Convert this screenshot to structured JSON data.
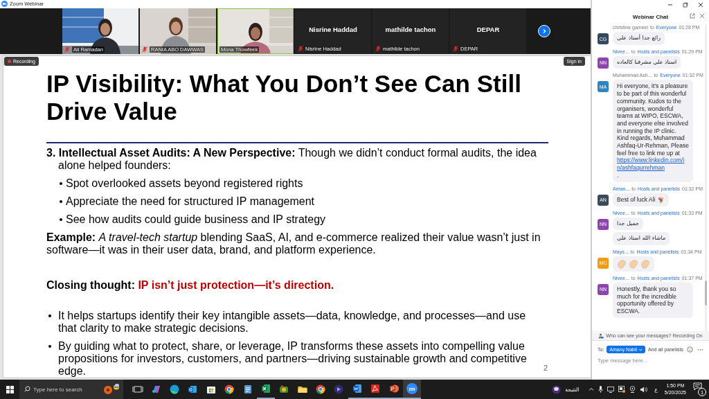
{
  "window": {
    "title": "Zoom Webinar"
  },
  "video_strip": {
    "tiles": [
      {
        "kind": "video",
        "name": "Ali Ramadan",
        "muted": true,
        "highlighted": false
      },
      {
        "kind": "video",
        "name": "RANIA ABO DAWWAS",
        "muted": true,
        "highlighted": false
      },
      {
        "kind": "video",
        "name": "Mona Thowfeek",
        "muted": false,
        "highlighted": true
      },
      {
        "kind": "name",
        "title": "Nisrine Haddad",
        "name": "Nisrine Haddad",
        "muted": true,
        "highlighted": false
      },
      {
        "kind": "name",
        "title": "mathilde tachon",
        "name": "mathilde tachon",
        "muted": true,
        "highlighted": false
      },
      {
        "kind": "name",
        "title": "DEPAR",
        "name": "DEPAR",
        "muted": true,
        "highlighted": false
      }
    ]
  },
  "recording": {
    "label": "Recording"
  },
  "sign_in": {
    "label": "Sign in"
  },
  "slide": {
    "title": "IP Visibility: What You Don’t See Can Still Drive Value",
    "blocks": [
      {
        "kind": "numbered",
        "text": "**3. Intellectual Asset Audits: A New Perspective:** Though we didn’t conduct formal audits, the idea alone helped founders:"
      },
      {
        "kind": "sub_bullet",
        "text": "Spot overlooked assets beyond registered rights"
      },
      {
        "kind": "sub_bullet",
        "text": "Appreciate the need for structured IP management"
      },
      {
        "kind": "sub_bullet",
        "text": "See how audits could guide business and IP strategy"
      },
      {
        "kind": "paragraph",
        "text": "**Example:** *A travel-tech startup* blending SaaS, AI, and e-commerce realized their value wasn’t just in software—it was in their user data, brand, and platform experience."
      },
      {
        "kind": "closing",
        "label": "Closing thought:",
        "emphasis": "IP isn’t just protection—it’s direction."
      },
      {
        "kind": "bullet",
        "text": "It helps startups identify their key intangible assets—data, knowledge, and processes—and use that clarity to make strategic decisions."
      },
      {
        "kind": "bullet",
        "text": "By guiding what to protect, share, or leverage, IP transforms these assets into compelling value propositions for investors, customers, and partners—driving sustainable growth and competitive edge."
      }
    ],
    "page_number": "2"
  },
  "chat": {
    "title": "Webinar Chat",
    "messages": [
      {
        "sender": "christine gameel",
        "sender_link": false,
        "to_label": "to",
        "recipient": "Everyone",
        "time": "01:28 PM",
        "initials": "CG",
        "color": "#34495e",
        "bubbles": [
          {
            "kind": "text",
            "text": "رائع جدا أستاذ علي"
          }
        ]
      },
      {
        "sender": "Nivee...",
        "sender_link": true,
        "to_label": "to",
        "recipient": "Hosts and panelists",
        "time": "01:29 PM",
        "initials": "NN",
        "color": "#8e44ad",
        "bubbles": [
          {
            "kind": "text",
            "text": "استاذ علي مشرفنا كالعاده"
          }
        ]
      },
      {
        "sender": "Muhammad Ash...",
        "sender_link": false,
        "to_label": "to",
        "recipient": "Everyone",
        "time": "01:32 PM",
        "initials": "MA",
        "color": "#2e86c1",
        "bubbles": [
          {
            "kind": "link",
            "text": "Hi everyone, it’s a pleasure to be part of this wonderful community. Kudos to the organisers, wonderful teams at WIPO, ESCWA, and everyone else involved in running the IP clinic. Kind regards, Muhammad Ashfaq-Ur-Rehman, Please feel free to link me up at",
            "link": "https://www.linkedin.com/in/ashfaqurrehman",
            "after": "."
          }
        ]
      },
      {
        "sender": "Aman...",
        "sender_link": true,
        "to_label": "to",
        "recipient": "Hosts and panelists",
        "time": "01:32 PM",
        "initials": "AN",
        "color": "#3b4a5a",
        "bubbles": [
          {
            "kind": "flower",
            "text": "Best of luck Ali"
          }
        ]
      },
      {
        "sender": "Nivee...",
        "sender_link": true,
        "to_label": "to",
        "recipient": "Hosts and panelists",
        "time": "01:33 PM",
        "initials": "NN",
        "color": "#8e44ad",
        "bubbles": [
          {
            "kind": "text",
            "text": "جميل جدا"
          },
          {
            "kind": "text",
            "text": "ماشاء الله استاذ علي"
          }
        ]
      },
      {
        "sender": "Mays...",
        "sender_link": true,
        "to_label": "to",
        "recipient": "Hosts and panelists",
        "time": "01:34 PM",
        "initials": "MC",
        "color": "#f39c12",
        "bubbles": [
          {
            "kind": "claps"
          }
        ]
      },
      {
        "sender": "Nivee...",
        "sender_link": true,
        "to_label": "to",
        "recipient": "Hosts and panelists",
        "time": "01:37 PM",
        "initials": "NN",
        "color": "#8e44ad",
        "bubbles": [
          {
            "kind": "text",
            "text": "Honestly, thank you so much for the incredible opportunity offered by ESCWA."
          }
        ]
      }
    ],
    "privacy_note": "Who can see your messages? Recording On",
    "to_label": "To:",
    "recipient_button": "Amany Nabil",
    "recipient_extra": "And all panelists",
    "input": {
      "placeholder": "Type message here..."
    }
  },
  "taskbar": {
    "search": {
      "placeholder": "Type here to search"
    },
    "apps": [
      {
        "kind": "task-view",
        "running": false,
        "active": false
      },
      {
        "kind": "copilot",
        "running": false,
        "active": false
      },
      {
        "kind": "edge",
        "running": false,
        "active": false
      },
      {
        "kind": "outlook",
        "running": false,
        "active": false
      },
      {
        "kind": "store",
        "running": false,
        "active": false
      },
      {
        "kind": "chrome",
        "running": false,
        "active": false
      },
      {
        "kind": "notes",
        "running": false,
        "active": false
      },
      {
        "kind": "excel",
        "running": true,
        "active": false
      },
      {
        "kind": "camera",
        "running": false,
        "active": false
      },
      {
        "kind": "explorer",
        "running": false,
        "active": false
      },
      {
        "kind": "chrome",
        "running": false,
        "active": false
      },
      {
        "kind": "media",
        "running": false,
        "active": false
      },
      {
        "kind": "word",
        "running": true,
        "active": false
      },
      {
        "kind": "acrobat",
        "running": true,
        "active": false
      },
      {
        "kind": "powerpoint",
        "running": true,
        "active": false
      },
      {
        "kind": "zoom",
        "label": "zm",
        "running": true,
        "active": true
      }
    ],
    "tray": {
      "widget_label": "النتيجة",
      "language": "ع",
      "time": "1:50 PM",
      "date": "5/20/2025",
      "notification_count": "1"
    }
  }
}
